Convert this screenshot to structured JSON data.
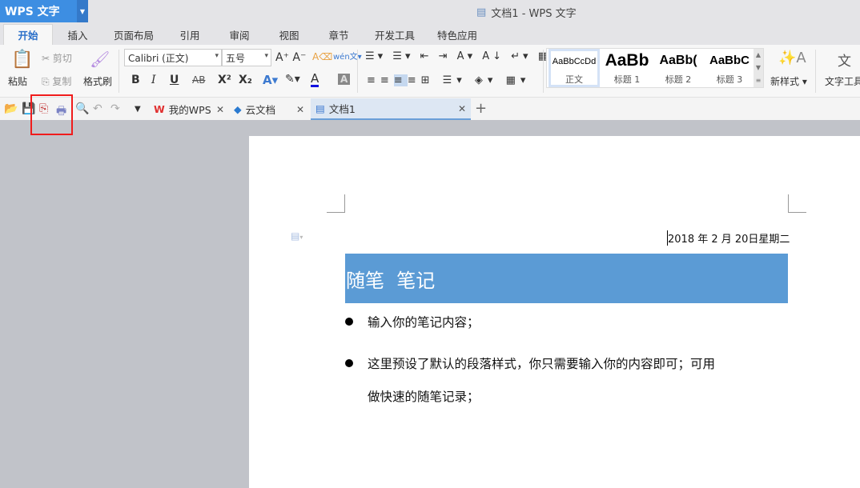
{
  "app": {
    "name": "WPS 文字",
    "window_title": "文档1 - WPS 文字"
  },
  "menu_tabs": [
    "开始",
    "插入",
    "页面布局",
    "引用",
    "审阅",
    "视图",
    "章节",
    "开发工具",
    "特色应用"
  ],
  "ribbon": {
    "paste": "粘贴",
    "cut": "剪切",
    "copy": "复制",
    "format_painter": "格式刷",
    "font": "Calibri (正文)",
    "size": "五号",
    "bold": "B",
    "italic": "I",
    "underline": "U",
    "strike": "AB",
    "superscript": "X²",
    "subscript": "X₂",
    "styles": [
      {
        "sample": "AaBbCcDd",
        "name": "正文"
      },
      {
        "sample": "AaBb",
        "name": "标题 1"
      },
      {
        "sample": "AaBb(",
        "name": "标题 2"
      },
      {
        "sample": "AaBbC",
        "name": "标题 3"
      }
    ],
    "new_style": "新样式",
    "text_tools": "文字工具"
  },
  "doc_tabs": [
    {
      "label": "我的WPS"
    },
    {
      "label": "云文档"
    },
    {
      "label": "文档1"
    }
  ],
  "document": {
    "date": "2018 年 2 月 20日星期二",
    "heading": "随笔  笔记",
    "bullets": [
      "输入你的笔记内容；",
      "这里预设了默认的段落样式，你只需要输入你的内容即可；可用",
      "做快速的随笔记录；"
    ]
  },
  "colors": {
    "accent": "#3d8ee2",
    "heading_bg": "#5b9bd5",
    "highlight": "#f01c1c"
  }
}
